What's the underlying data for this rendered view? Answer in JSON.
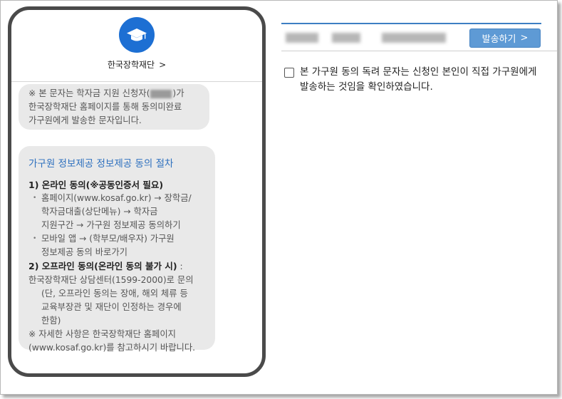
{
  "phone": {
    "sender_name": "한국장학재단",
    "sender_chevron": ">",
    "message1": {
      "line1_a": "※ 본 문자는 학자금 지원 신청자(",
      "line1_b": ")가",
      "line2": "한국장학재단 홈페이지를 통해 동의미완료",
      "line3": "가구원에게 발송한 문자입니다."
    },
    "message2": {
      "title": "가구원 정보제공 정보제공 동의 절차",
      "step1_heading": "1) 온라인 동의(※공동인증서 필요)",
      "step1_item1_l1": "홈페이지(www.kosaf.go.kr) → 장학금/",
      "step1_item1_l2": "학자금대출(상단메뉴) → 학자금",
      "step1_item1_l3": "지원구간 → 가구원 정보제공 동의하기",
      "step1_item2_l1": "모바일 앱 → (학부모/배우자) 가구원",
      "step1_item2_l2": "정보제공 동의 바로가기",
      "step2_heading": "2) 오프라인 동의(온라인 동의 불가 시)",
      "step2_colon": " :",
      "step2_l1": "한국장학재단 상담센터(1599-2000)로 문의",
      "step2_l2": "(단, 오프라인 동의는 장애, 해외 체류 등",
      "step2_l3": "교육부장관 및 재단이 인정하는 경우에",
      "step2_l4": "한함)",
      "note_l1": "※ 자세한 사항은 한국장학재단 홈페이지",
      "note_l2": "(www.kosaf.go.kr)를 참고하시기 바랍니다."
    }
  },
  "right": {
    "send_button_label": "발송하기",
    "send_button_chevron": ">",
    "confirm_text": "본 가구원 동의 독려 문자는 신청인 본인이 직접 가구원에게 발송하는 것임을 확인하였습니다."
  },
  "colors": {
    "accent": "#1d6fd3",
    "button": "#5e9ad5",
    "title_blue": "#2c6fbe",
    "bubble": "#e9e9e9"
  },
  "icons": {
    "logo": "graduation-cap-icon",
    "chevron": "chevron-right-icon"
  }
}
